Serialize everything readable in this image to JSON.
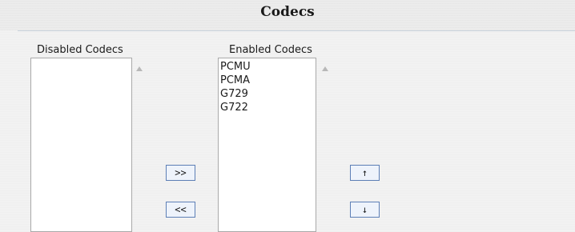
{
  "section": {
    "title": "Codecs"
  },
  "disabled": {
    "label": "Disabled Codecs",
    "items": []
  },
  "enabled": {
    "label": "Enabled Codecs",
    "items": [
      "PCMU",
      "PCMA",
      "G729",
      "G722"
    ]
  },
  "buttons": {
    "enable": ">>",
    "disable": "<<",
    "move_up": "↑",
    "move_down": "↓"
  },
  "colors": {
    "button_border": "#5d7fb6",
    "button_fill": "#eef3fb",
    "list_border": "#a9a9a9"
  }
}
